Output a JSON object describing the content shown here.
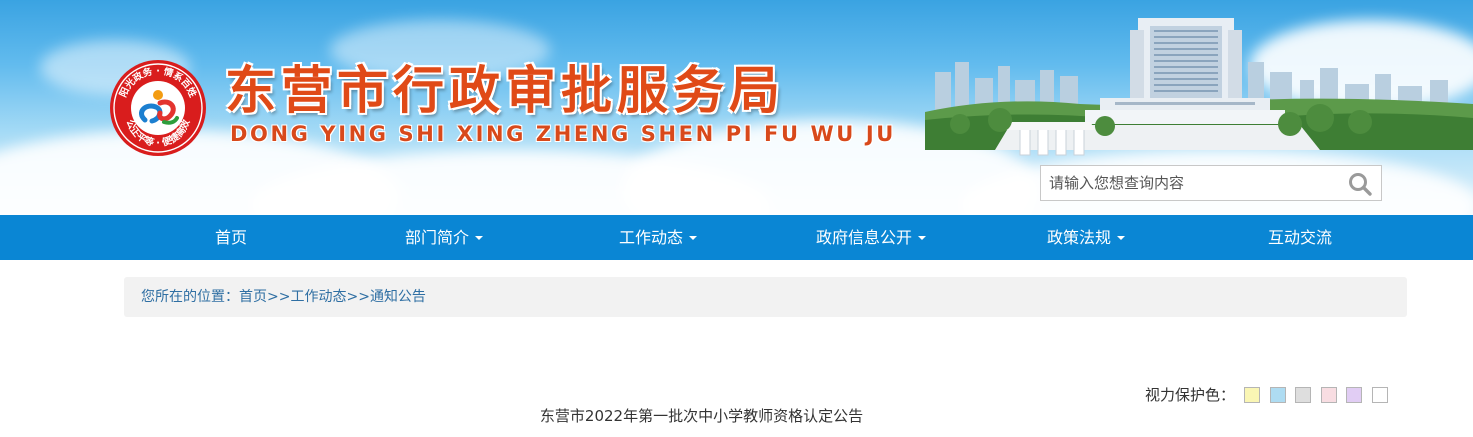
{
  "header": {
    "title_cn": "东营市行政审批服务局",
    "title_en": "DONG YING SHI XING ZHENG SHEN PI FU WU JU",
    "logo_text": [
      "阳光政务",
      "情系百姓",
      "公正平等",
      "便捷高效"
    ]
  },
  "search": {
    "placeholder": "请输入您想查询内容",
    "icon": "search-icon"
  },
  "nav": {
    "items": [
      {
        "label": "首页",
        "dropdown": false
      },
      {
        "label": "部门简介",
        "dropdown": true
      },
      {
        "label": "工作动态",
        "dropdown": true
      },
      {
        "label": "政府信息公开",
        "dropdown": true
      },
      {
        "label": "政策法规",
        "dropdown": true
      },
      {
        "label": "互动交流",
        "dropdown": false
      }
    ]
  },
  "breadcrumb": {
    "prefix": "您所在的位置：",
    "items": [
      "首页",
      "工作动态",
      "通知公告"
    ],
    "separator": ">>"
  },
  "eye_protection": {
    "label": "视力保护色：",
    "colors": [
      "#faf6b4",
      "#aedcf2",
      "#dedede",
      "#f8dde2",
      "#e1cdf4",
      "#ffffff"
    ]
  },
  "article": {
    "title": "东营市2022年第一批次中小学教师资格认定公告"
  },
  "theme": {
    "nav_bg": "#0a86d4",
    "title_color": "#e04a17",
    "link_color": "#2f6fa3"
  }
}
